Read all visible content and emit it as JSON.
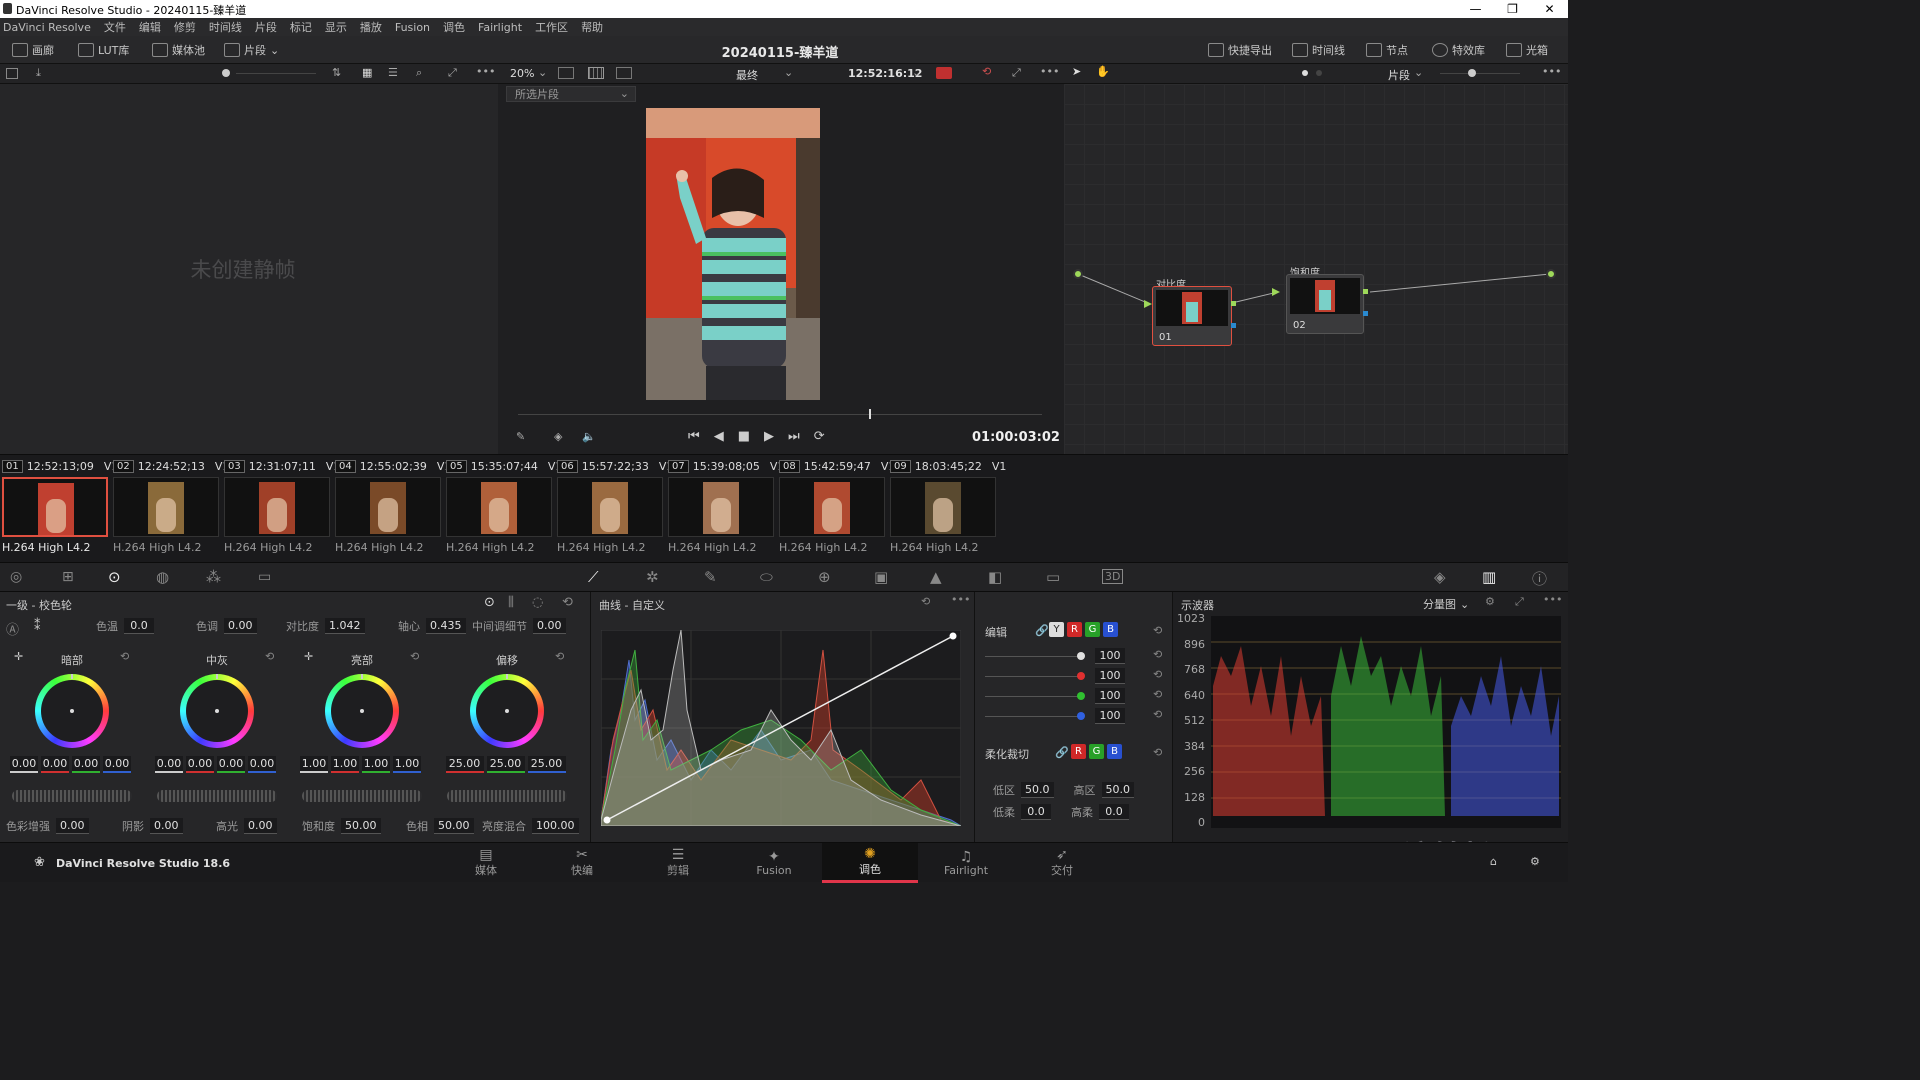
{
  "window": {
    "title": "DaVinci Resolve Studio - 20240115-臻羊道",
    "controls": [
      "—",
      "❐",
      "✕"
    ]
  },
  "menu": [
    "DaVinci Resolve",
    "文件",
    "编辑",
    "修剪",
    "时间线",
    "片段",
    "标记",
    "显示",
    "播放",
    "Fusion",
    "调色",
    "Fairlight",
    "工作区",
    "帮助"
  ],
  "toolbar": {
    "left": [
      {
        "label": "画廊",
        "icon": "gallery-icon"
      },
      {
        "label": "LUT库",
        "icon": "lut-icon"
      },
      {
        "label": "媒体池",
        "icon": "media-pool-icon"
      },
      {
        "label": "片段",
        "icon": "clips-icon"
      }
    ],
    "project_title": "20240115-臻羊道",
    "right": [
      {
        "label": "快捷导出",
        "icon": "export-icon"
      },
      {
        "label": "时间线",
        "icon": "timeline-icon"
      },
      {
        "label": "节点",
        "icon": "nodes-icon"
      },
      {
        "label": "特效库",
        "icon": "fx-icon"
      },
      {
        "label": "光箱",
        "icon": "lightbox-icon"
      }
    ]
  },
  "viewer": {
    "zoom": "20%",
    "mode": "最终",
    "timecode": "12:52:16:12",
    "clip_select": "所选片段",
    "playhead_tc": "01:00:03:02",
    "progress": 0.67
  },
  "gallery": {
    "empty_text": "未创建静帧"
  },
  "nodes_panel": {
    "mode": "片段",
    "nodes": [
      {
        "label": "对比度",
        "id": "01"
      },
      {
        "label": "饱和度",
        "id": "02"
      }
    ]
  },
  "clips": [
    {
      "num": "01",
      "tc": "12:52:13;09",
      "track": "V1",
      "codec": "H.264 High L4.2",
      "color": "#c04030",
      "selected": true
    },
    {
      "num": "02",
      "tc": "12:24:52;13",
      "track": "V1",
      "codec": "H.264 High L4.2",
      "color": "#8a6a3a",
      "selected": false
    },
    {
      "num": "03",
      "tc": "12:31:07;11",
      "track": "V1",
      "codec": "H.264 High L4.2",
      "color": "#a04028",
      "selected": false
    },
    {
      "num": "04",
      "tc": "12:55:02;39",
      "track": "V1",
      "codec": "H.264 High L4.2",
      "color": "#7a4a28",
      "selected": false
    },
    {
      "num": "05",
      "tc": "15:35:07;44",
      "track": "V1",
      "codec": "H.264 High L4.2",
      "color": "#b0603a",
      "selected": false
    },
    {
      "num": "06",
      "tc": "15:57:22;33",
      "track": "V1",
      "codec": "H.264 High L4.2",
      "color": "#9a6a40",
      "selected": false
    },
    {
      "num": "07",
      "tc": "15:39:08;05",
      "track": "V1",
      "codec": "H.264 High L4.2",
      "color": "#a07050",
      "selected": false
    },
    {
      "num": "08",
      "tc": "15:42:59;47",
      "track": "V1",
      "codec": "H.264 High L4.2",
      "color": "#b04a30",
      "selected": false
    },
    {
      "num": "09",
      "tc": "18:03:45;22",
      "track": "V1",
      "codec": "H.264 High L4.2",
      "color": "#5a4a30",
      "selected": false
    }
  ],
  "primaries": {
    "title": "一级 - 校色轮",
    "top": [
      {
        "label": "色温",
        "value": "0.0"
      },
      {
        "label": "色调",
        "value": "0.00"
      },
      {
        "label": "对比度",
        "value": "1.042"
      },
      {
        "label": "轴心",
        "value": "0.435"
      },
      {
        "label": "中间调细节",
        "value": "0.00"
      }
    ],
    "wheels": [
      {
        "label": "暗部",
        "values": [
          "0.00",
          "0.00",
          "0.00",
          "0.00"
        ]
      },
      {
        "label": "中灰",
        "values": [
          "0.00",
          "0.00",
          "0.00",
          "0.00"
        ]
      },
      {
        "label": "亮部",
        "values": [
          "1.00",
          "1.00",
          "1.00",
          "1.00"
        ]
      },
      {
        "label": "偏移",
        "values": [
          "25.00",
          "25.00",
          "25.00"
        ]
      }
    ],
    "bottom": [
      {
        "label": "色彩增强",
        "value": "0.00"
      },
      {
        "label": "阴影",
        "value": "0.00"
      },
      {
        "label": "高光",
        "value": "0.00"
      },
      {
        "label": "饱和度",
        "value": "50.00"
      },
      {
        "label": "色相",
        "value": "50.00"
      },
      {
        "label": "亮度混合",
        "value": "100.00"
      }
    ]
  },
  "curves": {
    "title": "曲线 - 自定义"
  },
  "curve_controls": {
    "edit_label": "编辑",
    "channels": [
      "Y",
      "R",
      "G",
      "B"
    ],
    "intensity": [
      {
        "color": "#e0e0e0",
        "value": "100"
      },
      {
        "color": "#e03030",
        "value": "100"
      },
      {
        "color": "#30c030",
        "value": "100"
      },
      {
        "color": "#3060e0",
        "value": "100"
      }
    ],
    "soft_clip_label": "柔化裁切",
    "soft": [
      {
        "label": "低区",
        "value": "50.0"
      },
      {
        "label": "高区",
        "value": "50.0"
      },
      {
        "label": "低柔",
        "value": "0.0"
      },
      {
        "label": "高柔",
        "value": "0.0"
      }
    ]
  },
  "scope": {
    "title": "示波器",
    "mode": "分量图",
    "ticks": [
      "1023",
      "896",
      "768",
      "640",
      "512",
      "384",
      "256",
      "128",
      "0"
    ],
    "watermark": "<滚轮松开>"
  },
  "pages": [
    {
      "label": "媒体",
      "icon": "media-page-icon",
      "glyph": "▤"
    },
    {
      "label": "快编",
      "icon": "cut-page-icon",
      "glyph": "✂"
    },
    {
      "label": "剪辑",
      "icon": "edit-page-icon",
      "glyph": "☰"
    },
    {
      "label": "Fusion",
      "icon": "fusion-page-icon",
      "glyph": "✦"
    },
    {
      "label": "调色",
      "icon": "color-page-icon",
      "glyph": "✺",
      "active": true
    },
    {
      "label": "Fairlight",
      "icon": "fairlight-page-icon",
      "glyph": "♫"
    },
    {
      "label": "交付",
      "icon": "deliver-page-icon",
      "glyph": "➶"
    }
  ],
  "app_brand": "DaVinci Resolve Studio 18.6"
}
